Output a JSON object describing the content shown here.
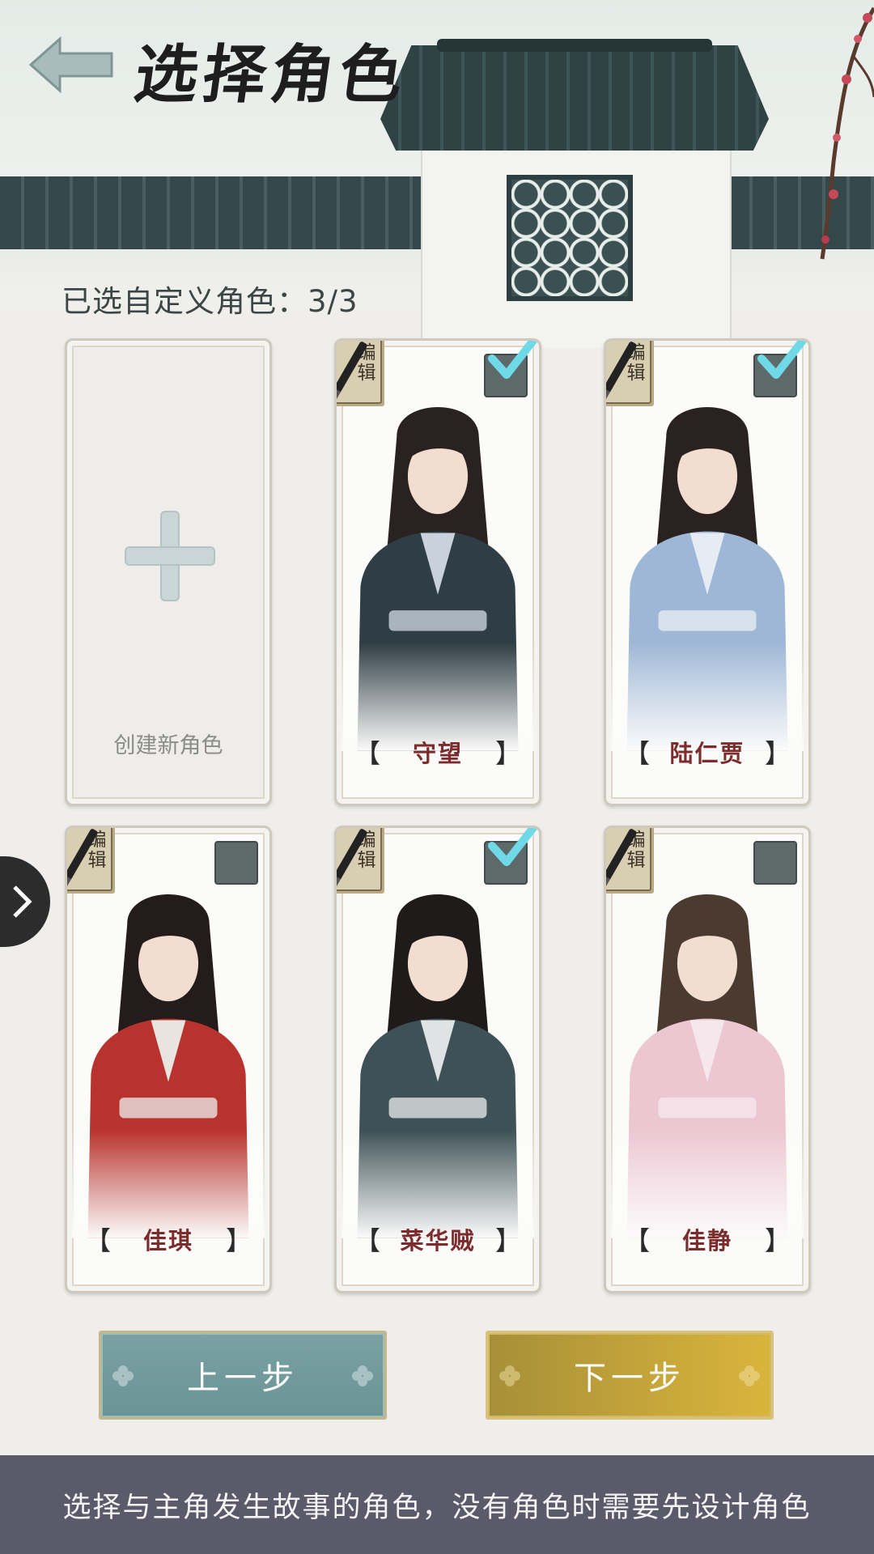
{
  "header": {
    "title": "选择角色",
    "back_icon": "back-arrow-icon"
  },
  "selection": {
    "count_text": "已选自定义角色：3/3"
  },
  "create_card": {
    "label": "创建新角色",
    "icon": "plus-icon"
  },
  "edit_label": "编辑",
  "characters": [
    {
      "name": "守望",
      "checked": true,
      "robe": "#2f3e44",
      "accent": "#c9d2dc",
      "hair": "#2a2220"
    },
    {
      "name": "陆仁贾",
      "checked": true,
      "robe": "#9fb7d6",
      "accent": "#e6ecf3",
      "hair": "#2a2220"
    },
    {
      "name": "佳琪",
      "checked": false,
      "robe": "#b8332d",
      "accent": "#e9e4e0",
      "hair": "#231c1a"
    },
    {
      "name": "菜华贼",
      "checked": true,
      "robe": "#3e5156",
      "accent": "#dfe3e4",
      "hair": "#1f1b1a"
    },
    {
      "name": "佳静",
      "checked": false,
      "robe": "#ecc7d2",
      "accent": "#f6e7ec",
      "hair": "#4a3a30"
    }
  ],
  "buttons": {
    "prev": "上一步",
    "next": "下一步"
  },
  "footer": {
    "hint": "选择与主角发生故事的角色，没有角色时需要先设计角色"
  },
  "colors": {
    "check_cyan": "#6fd9e8",
    "prev_button": "#7aa2a5",
    "next_button": "#c7a63a",
    "footer_bg": "#5b5a6a"
  }
}
